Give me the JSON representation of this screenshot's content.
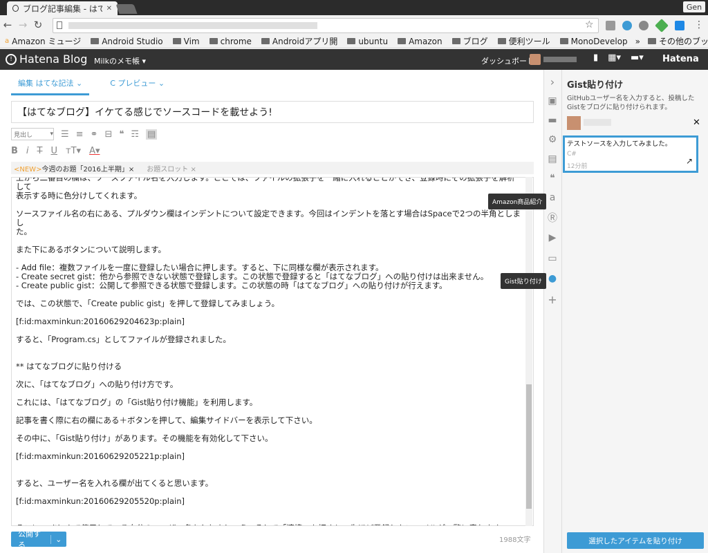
{
  "browser": {
    "tab_title": "ブログ記事編集 - はてな",
    "user_chip": "Gen",
    "bookmarks": [
      "Amazon ミュージ",
      "Android Studio",
      "Vim",
      "chrome",
      "Androidアプリ開",
      "ubuntu",
      "Amazon",
      "ブログ",
      "便利ツール",
      "MonoDevelop",
      "その他のブックマーク"
    ]
  },
  "hatena_bar": {
    "logo": "Hatena Blog",
    "blog_name": "Milkのメモ帳 ▾",
    "dashboard": "ダッシュボード",
    "brand": "Hatena"
  },
  "editor": {
    "tab_edit": "編集 はてな記法 ⌄",
    "tab_preview": "C プレビュー ⌄",
    "title": "【はてなブログ】イケてる感じでソースコードを載せよう!",
    "heading_select": "見出し",
    "topic_new_tag": "<NEW>",
    "topic_new": "今週のお題「2016上半期」×",
    "topic_slot": "お題スロット ×",
    "body": "上から二番目の欄は、ソースファイル名を入力します。ここでは、ファイルの拡張子を一緒に入れることができ、登録時にその拡張子を解析して\n表示する時に色分けしてくれます。\n\nソースファイル名の右にある、プルダウン欄はインデントについて設定できます。今回はインデントを落とす場合はSpaceで2つの半角としまし\nた。\n\nまた下にあるボタンについて説明します。\n\n- Add file：複数ファイルを一度に登録したい場合に押します。すると、下に同様な欄が表示されます。\n- Create secret gist：他から参照できない状態で登録します。この状態で登録すると「はてなブログ」への貼り付けは出来ません。\n- Create public gist：公開して参照できる状態で登録します。この状態の時「はてなブログ」への貼り付けが行えます。\n\nでは、この状態で、「Create public gist」を押して登録してみましょう。\n\n[f:id:maxminkun:20160629204623p:plain]\n\nすると、「Program.cs」としてファイルが登録されました。\n\n\n** はてなブログに貼り付ける\n\n次に、「はてなブログ」への貼り付け方です。\n\nこれには、「はてなブログ」の「Gist貼り付け機能」を利用します。\n\n記事を書く際に右の欄にある＋ボタンを押して、編集サイドバーを表示して下さい。\n\nその中に、「Gist貼り付け」があります。その機能を有効化して下さい。\n\n[f:id:maxminkun:20160629205221p:plain]\n\n\nすると、ユーザー名を入れる欄が出てくると思います。\n\n[f:id:maxminkun:20160629205520p:plain]\n\n\nそこに、githubで使用している自分のユーザー名を入れましょう。そして「連携」を押すと、先ほど登録したファイルが一覧に表れます。",
    "publish": "公開する",
    "char_count": "1988文字"
  },
  "tooltips": {
    "amazon": "Amazon商品紹介",
    "gist": "Gist貼り付け"
  },
  "panel": {
    "title": "Gist貼り付け",
    "description": "GitHubユーザー名を入力すると、投稿したGistをブログに貼り付けられます。",
    "gist_item": {
      "description": "テストソースを入力してみました。",
      "language": "C#",
      "time": "12分前"
    },
    "paste_button": "選択したアイテムを貼り付け"
  },
  "colors": {
    "accent": "#3d9bd5",
    "topbar": "#333333",
    "new_tag": "#f0a030"
  }
}
